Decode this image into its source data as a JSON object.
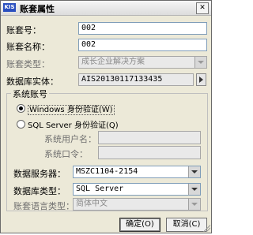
{
  "window": {
    "icon_text": "KIS",
    "title": "账套属性",
    "close_glyph": "✕"
  },
  "fields": {
    "account_no": {
      "label": "账套号：",
      "value": "002"
    },
    "account_name": {
      "label": "账套名称：",
      "value": "002"
    },
    "account_type": {
      "label": "账套类型：",
      "value": "成长企业解决方案",
      "disabled": true
    },
    "db_entity": {
      "label": "数据库实体：",
      "value": "AIS20130117133435"
    }
  },
  "system_account": {
    "group_title": "系统账号",
    "windows_auth": {
      "label": "Windows 身份验证(W)",
      "selected": true
    },
    "sql_auth": {
      "label": "SQL Server 身份验证(Q)",
      "selected": false
    },
    "username_label": "系统用户名：",
    "password_label": "系统口令：",
    "server": {
      "label": "数据服务器：",
      "value": "MSZC1104-2154"
    },
    "db_type": {
      "label": "数据库类型：",
      "value": "SQL Server"
    },
    "language": {
      "label": "账套语言类型：",
      "value": "简体中文",
      "disabled": true
    }
  },
  "buttons": {
    "ok": "确定(O)",
    "cancel": "取消(C)"
  }
}
